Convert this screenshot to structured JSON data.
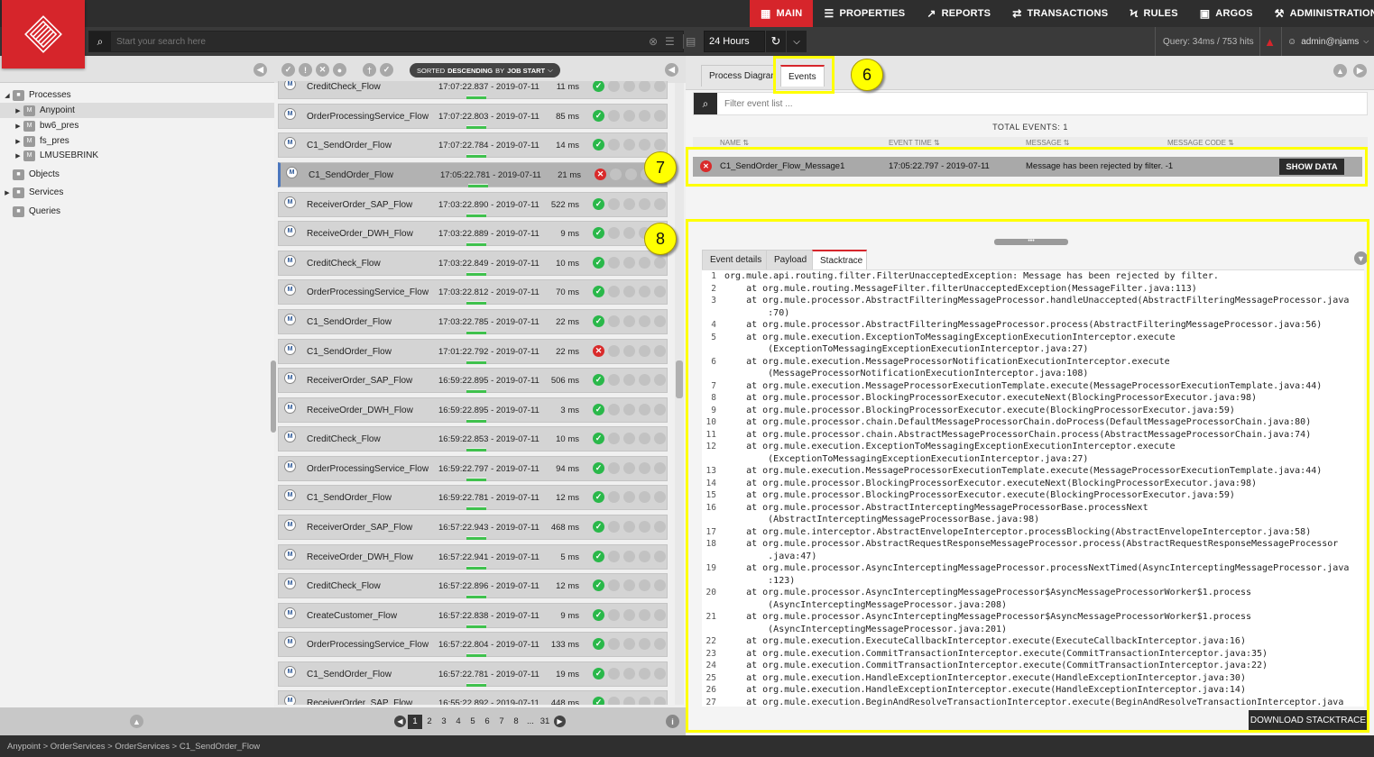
{
  "nav": {
    "items": [
      {
        "label": "MAIN",
        "icon": "table-icon",
        "active": true
      },
      {
        "label": "PROPERTIES",
        "icon": "list-icon",
        "active": false
      },
      {
        "label": "REPORTS",
        "icon": "chart-icon",
        "active": false
      },
      {
        "label": "TRANSACTIONS",
        "icon": "swap-icon",
        "active": false
      },
      {
        "label": "RULES",
        "icon": "bolt-icon",
        "active": false
      },
      {
        "label": "ARGOS",
        "icon": "target-icon",
        "active": false
      },
      {
        "label": "ADMINISTRATION",
        "icon": "wrench-icon",
        "active": false
      }
    ]
  },
  "search": {
    "placeholder": "Start your search here"
  },
  "time_range": "24 Hours",
  "query_stats": "Query: 34ms / 753 hits",
  "user": "admin@njams",
  "tree": [
    {
      "label": "Processes",
      "level": 0
    },
    {
      "label": "Anypoint",
      "level": 1,
      "selected": true
    },
    {
      "label": "bw6_pres",
      "level": 1
    },
    {
      "label": "fs_pres",
      "level": 1
    },
    {
      "label": "LMUSEBRINK",
      "level": 1
    },
    {
      "label": "Objects",
      "level": 0
    },
    {
      "label": "Services",
      "level": 0
    },
    {
      "label": "Queries",
      "level": 0
    }
  ],
  "sort": {
    "prefix": "SORTED",
    "order": "DESCENDING",
    "by": "BY",
    "field": "JOB START"
  },
  "executions": [
    {
      "name": "CreditCheck_Flow",
      "time": "17:07:22.837 - 2019-07-11",
      "duration": "11 ms",
      "status": "ok"
    },
    {
      "name": "OrderProcessingService_Flow",
      "time": "17:07:22.803 - 2019-07-11",
      "duration": "85 ms",
      "status": "ok"
    },
    {
      "name": "C1_SendOrder_Flow",
      "time": "17:07:22.784 - 2019-07-11",
      "duration": "14 ms",
      "status": "ok"
    },
    {
      "name": "C1_SendOrder_Flow",
      "time": "17:05:22.781 - 2019-07-11",
      "duration": "21 ms",
      "status": "err",
      "selected": true
    },
    {
      "name": "ReceiverOrder_SAP_Flow",
      "time": "17:03:22.890 - 2019-07-11",
      "duration": "522 ms",
      "status": "ok"
    },
    {
      "name": "ReceiveOrder_DWH_Flow",
      "time": "17:03:22.889 - 2019-07-11",
      "duration": "9 ms",
      "status": "ok"
    },
    {
      "name": "CreditCheck_Flow",
      "time": "17:03:22.849 - 2019-07-11",
      "duration": "10 ms",
      "status": "ok"
    },
    {
      "name": "OrderProcessingService_Flow",
      "time": "17:03:22.812 - 2019-07-11",
      "duration": "70 ms",
      "status": "ok"
    },
    {
      "name": "C1_SendOrder_Flow",
      "time": "17:03:22.785 - 2019-07-11",
      "duration": "22 ms",
      "status": "ok"
    },
    {
      "name": "C1_SendOrder_Flow",
      "time": "17:01:22.792 - 2019-07-11",
      "duration": "22 ms",
      "status": "err"
    },
    {
      "name": "ReceiverOrder_SAP_Flow",
      "time": "16:59:22.895 - 2019-07-11",
      "duration": "506 ms",
      "status": "ok"
    },
    {
      "name": "ReceiveOrder_DWH_Flow",
      "time": "16:59:22.895 - 2019-07-11",
      "duration": "3 ms",
      "status": "ok"
    },
    {
      "name": "CreditCheck_Flow",
      "time": "16:59:22.853 - 2019-07-11",
      "duration": "10 ms",
      "status": "ok"
    },
    {
      "name": "OrderProcessingService_Flow",
      "time": "16:59:22.797 - 2019-07-11",
      "duration": "94 ms",
      "status": "ok"
    },
    {
      "name": "C1_SendOrder_Flow",
      "time": "16:59:22.781 - 2019-07-11",
      "duration": "12 ms",
      "status": "ok"
    },
    {
      "name": "ReceiverOrder_SAP_Flow",
      "time": "16:57:22.943 - 2019-07-11",
      "duration": "468 ms",
      "status": "ok"
    },
    {
      "name": "ReceiveOrder_DWH_Flow",
      "time": "16:57:22.941 - 2019-07-11",
      "duration": "5 ms",
      "status": "ok"
    },
    {
      "name": "CreditCheck_Flow",
      "time": "16:57:22.896 - 2019-07-11",
      "duration": "12 ms",
      "status": "ok"
    },
    {
      "name": "CreateCustomer_Flow",
      "time": "16:57:22.838 - 2019-07-11",
      "duration": "9 ms",
      "status": "ok"
    },
    {
      "name": "OrderProcessingService_Flow",
      "time": "16:57:22.804 - 2019-07-11",
      "duration": "133 ms",
      "status": "ok"
    },
    {
      "name": "C1_SendOrder_Flow",
      "time": "16:57:22.781 - 2019-07-11",
      "duration": "19 ms",
      "status": "ok"
    },
    {
      "name": "ReceiverOrder_SAP_Flow",
      "time": "16:55:22.892 - 2019-07-11",
      "duration": "448 ms",
      "status": "ok"
    }
  ],
  "pager": {
    "pages": [
      "1",
      "2",
      "3",
      "4",
      "5",
      "6",
      "7",
      "8",
      "...",
      "31"
    ],
    "current": "1"
  },
  "right_tabs": {
    "process_diagram": "Process Diagram",
    "events": "Events"
  },
  "filter": {
    "placeholder": "Filter event list ..."
  },
  "total_events": "TOTAL EVENTS: 1",
  "event_columns": [
    "NAME",
    "EVENT TIME",
    "MESSAGE",
    "MESSAGE CODE"
  ],
  "event": {
    "name": "C1_SendOrder_Flow_Message1",
    "time": "17:05:22.797 - 2019-07-11",
    "message": "Message has been rejected by filter. -1",
    "button": "SHOW DATA"
  },
  "detail_tabs": {
    "details": "Event details",
    "payload": "Payload",
    "stacktrace": "Stacktrace"
  },
  "stacktrace": [
    {
      "n": "1",
      "t": "org.mule.api.routing.filter.FilterUnacceptedException: Message has been rejected by filter."
    },
    {
      "n": "2",
      "t": "    at org.mule.routing.MessageFilter.filterUnacceptedException(MessageFilter.java:113)"
    },
    {
      "n": "3",
      "t": "    at org.mule.processor.AbstractFilteringMessageProcessor.handleUnaccepted(AbstractFilteringMessageProcessor.java"
    },
    {
      "n": "",
      "t": "        :70)"
    },
    {
      "n": "4",
      "t": "    at org.mule.processor.AbstractFilteringMessageProcessor.process(AbstractFilteringMessageProcessor.java:56)"
    },
    {
      "n": "5",
      "t": "    at org.mule.execution.ExceptionToMessagingExceptionExecutionInterceptor.execute"
    },
    {
      "n": "",
      "t": "        (ExceptionToMessagingExceptionExecutionInterceptor.java:27)"
    },
    {
      "n": "6",
      "t": "    at org.mule.execution.MessageProcessorNotificationExecutionInterceptor.execute"
    },
    {
      "n": "",
      "t": "        (MessageProcessorNotificationExecutionInterceptor.java:108)"
    },
    {
      "n": "7",
      "t": "    at org.mule.execution.MessageProcessorExecutionTemplate.execute(MessageProcessorExecutionTemplate.java:44)"
    },
    {
      "n": "8",
      "t": "    at org.mule.processor.BlockingProcessorExecutor.executeNext(BlockingProcessorExecutor.java:98)"
    },
    {
      "n": "9",
      "t": "    at org.mule.processor.BlockingProcessorExecutor.execute(BlockingProcessorExecutor.java:59)"
    },
    {
      "n": "10",
      "t": "    at org.mule.processor.chain.DefaultMessageProcessorChain.doProcess(DefaultMessageProcessorChain.java:80)"
    },
    {
      "n": "11",
      "t": "    at org.mule.processor.chain.AbstractMessageProcessorChain.process(AbstractMessageProcessorChain.java:74)"
    },
    {
      "n": "12",
      "t": "    at org.mule.execution.ExceptionToMessagingExceptionExecutionInterceptor.execute"
    },
    {
      "n": "",
      "t": "        (ExceptionToMessagingExceptionExecutionInterceptor.java:27)"
    },
    {
      "n": "13",
      "t": "    at org.mule.execution.MessageProcessorExecutionTemplate.execute(MessageProcessorExecutionTemplate.java:44)"
    },
    {
      "n": "14",
      "t": "    at org.mule.processor.BlockingProcessorExecutor.executeNext(BlockingProcessorExecutor.java:98)"
    },
    {
      "n": "15",
      "t": "    at org.mule.processor.BlockingProcessorExecutor.execute(BlockingProcessorExecutor.java:59)"
    },
    {
      "n": "16",
      "t": "    at org.mule.processor.AbstractInterceptingMessageProcessorBase.processNext"
    },
    {
      "n": "",
      "t": "        (AbstractInterceptingMessageProcessorBase.java:98)"
    },
    {
      "n": "17",
      "t": "    at org.mule.interceptor.AbstractEnvelopeInterceptor.processBlocking(AbstractEnvelopeInterceptor.java:58)"
    },
    {
      "n": "18",
      "t": "    at org.mule.processor.AbstractRequestResponseMessageProcessor.process(AbstractRequestResponseMessageProcessor"
    },
    {
      "n": "",
      "t": "        .java:47)"
    },
    {
      "n": "19",
      "t": "    at org.mule.processor.AsyncInterceptingMessageProcessor.processNextTimed(AsyncInterceptingMessageProcessor.java"
    },
    {
      "n": "",
      "t": "        :123)"
    },
    {
      "n": "20",
      "t": "    at org.mule.processor.AsyncInterceptingMessageProcessor$AsyncMessageProcessorWorker$1.process"
    },
    {
      "n": "",
      "t": "        (AsyncInterceptingMessageProcessor.java:208)"
    },
    {
      "n": "21",
      "t": "    at org.mule.processor.AsyncInterceptingMessageProcessor$AsyncMessageProcessorWorker$1.process"
    },
    {
      "n": "",
      "t": "        (AsyncInterceptingMessageProcessor.java:201)"
    },
    {
      "n": "22",
      "t": "    at org.mule.execution.ExecuteCallbackInterceptor.execute(ExecuteCallbackInterceptor.java:16)"
    },
    {
      "n": "23",
      "t": "    at org.mule.execution.CommitTransactionInterceptor.execute(CommitTransactionInterceptor.java:35)"
    },
    {
      "n": "24",
      "t": "    at org.mule.execution.CommitTransactionInterceptor.execute(CommitTransactionInterceptor.java:22)"
    },
    {
      "n": "25",
      "t": "    at org.mule.execution.HandleExceptionInterceptor.execute(HandleExceptionInterceptor.java:30)"
    },
    {
      "n": "26",
      "t": "    at org.mule.execution.HandleExceptionInterceptor.execute(HandleExceptionInterceptor.java:14)"
    },
    {
      "n": "27",
      "t": "    at org.mule.execution.BeginAndResolveTransactionInterceptor.execute(BeginAndResolveTransactionInterceptor.java"
    }
  ],
  "download_label": "DOWNLOAD STACKTRACE",
  "breadcrumb": "Anypoint > OrderServices > OrderServices > C1_SendOrder_Flow",
  "callouts": [
    "6",
    "7",
    "8"
  ],
  "colors": {
    "brand": "#d6252b",
    "ok": "#2ab84a",
    "error": "#d92a2a",
    "highlight": "#ffff00"
  }
}
